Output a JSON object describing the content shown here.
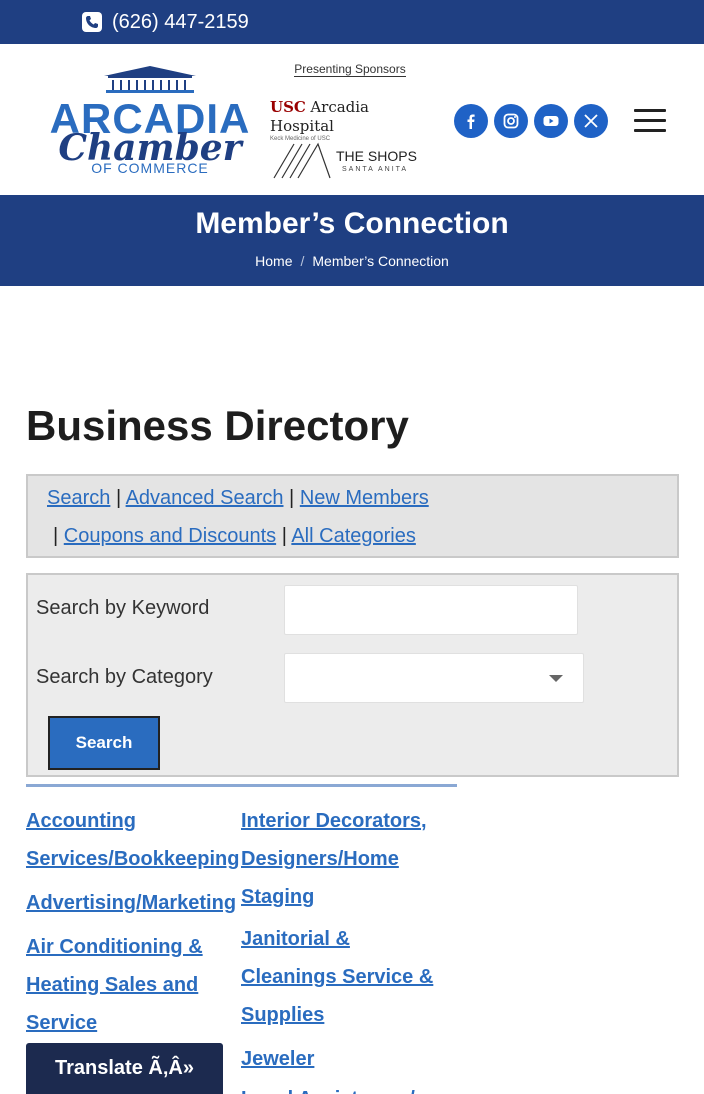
{
  "topbar": {
    "phone": "(626) 447-2159"
  },
  "header": {
    "logo": {
      "line1": "ARCADIA",
      "line2": "Chamber",
      "line3": "OF COMMERCE"
    },
    "sponsors": {
      "label": "Presenting Sponsors",
      "usc": {
        "brand": "USC",
        "name": "Arcadia Hospital",
        "sub": "Keck Medicine of USC"
      },
      "shops": {
        "name": "THE SHOPS",
        "sub": "SANTA ANITA"
      }
    },
    "social": [
      "facebook-icon",
      "instagram-icon",
      "youtube-icon",
      "x-icon"
    ]
  },
  "band": {
    "title": "Member’s Connection",
    "breadcrumb": {
      "home": "Home",
      "separator": "/",
      "current": "Member’s Connection"
    }
  },
  "directory": {
    "title": "Business Directory",
    "links": {
      "search": "Search",
      "advanced": "Advanced Search",
      "new_members": "New Members",
      "coupons": "Coupons and Discounts",
      "all_categories": "All Categories",
      "sep": "|"
    },
    "search_form": {
      "keyword_label": "Search by Keyword",
      "keyword_value": "",
      "category_label": "Search by Category",
      "category_value": "",
      "button": "Search"
    },
    "categories_left": [
      "Accounting",
      "Services/Bookkeeping",
      "Advertising/Marketing",
      "Air Conditioning &",
      "Heating Sales and",
      "Service"
    ],
    "categories_right": [
      "Interior Decorators,",
      "Designers/Home",
      "Staging",
      "Janitorial &",
      "Cleanings Service &",
      "Supplies",
      "Jeweler",
      "Legal Assistance /"
    ]
  },
  "translate": {
    "label": "Translate Ã‚Â»"
  },
  "colors": {
    "navy": "#1f3f82",
    "link_blue": "#2a6cbf",
    "social_blue": "#1f62c6"
  }
}
